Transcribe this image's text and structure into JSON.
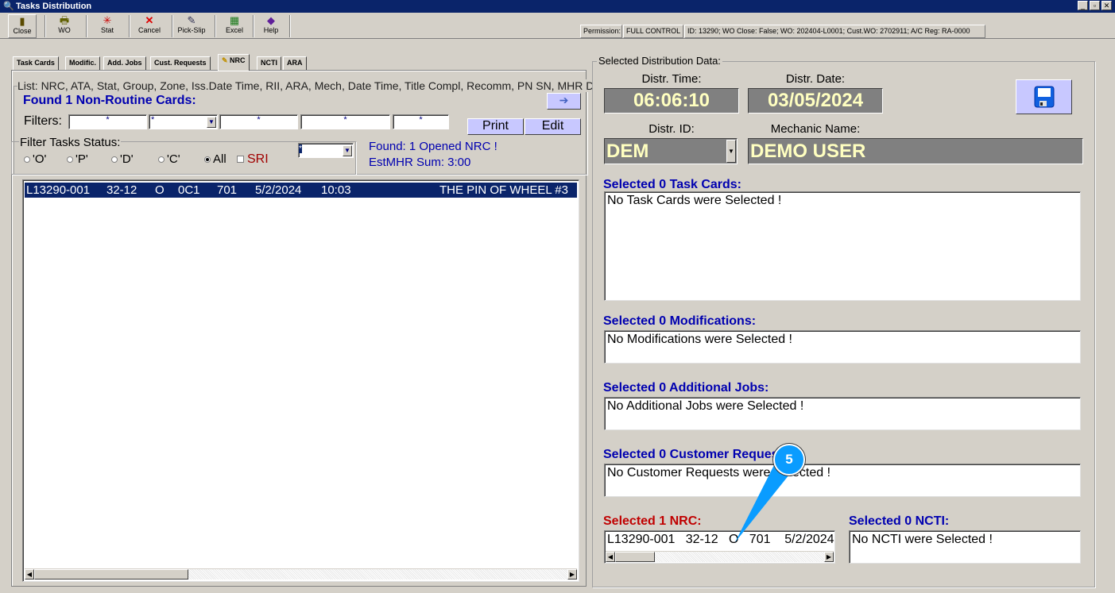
{
  "window": {
    "title": "Tasks Distribution"
  },
  "toolbar": [
    {
      "label": "Close",
      "icon": "door-exit-icon",
      "glyph": "🚪"
    },
    {
      "label": "WO",
      "icon": "printer-icon",
      "glyph": "🖶"
    },
    {
      "label": "Stat",
      "icon": "stat-burst-icon",
      "glyph": "✳"
    },
    {
      "label": "Cancel",
      "icon": "cancel-x-icon",
      "glyph": "✕"
    },
    {
      "label": "Pick-Slip",
      "icon": "pick-slip-icon",
      "glyph": "✎"
    },
    {
      "label": "Excel",
      "icon": "excel-icon",
      "glyph": "▦"
    },
    {
      "label": "Help",
      "icon": "help-book-icon",
      "glyph": "📘"
    }
  ],
  "status": {
    "permission_label": "Permission:",
    "permission_value": "FULL CONTROL",
    "info": "ID: 13290; WO Close: False; WO: 202404-L0001; Cust.WO: 2702911; A/C Reg: RA-0000"
  },
  "tabs": [
    "Task Cards",
    "Modific.",
    "Add. Jobs",
    "Cust. Requests",
    "NRC",
    "NCTI",
    "ARA"
  ],
  "left": {
    "list_caption": "List: NRC, ATA, Stat, Group, Zone, Iss.Date Time, RII, ARA, Mech, Date Time, Title Compl, Recomm, PN SN, MHR DwnT",
    "found_label": "Found 1 Non-Routine Cards:",
    "filters_label": "Filters:",
    "filters": [
      "*",
      "*",
      "*",
      "*",
      "*"
    ],
    "print": "Print",
    "edit": "Edit",
    "status_group": "Filter Tasks Status:",
    "radios": [
      "'O'",
      "'P'",
      "'D'",
      "'C'",
      "All"
    ],
    "sri": "SRI",
    "status_combo": "*",
    "found_opened": "Found: 1 Opened NRC !",
    "estmhr": "EstMHR Sum: 3:00",
    "rows": [
      {
        "nrc": "L13290-001",
        "ata": "32-12",
        "stat": "O",
        "group": "0C1",
        "zone": "701",
        "date": "5/2/2024",
        "time": "10:03",
        "title": "THE PIN OF WHEEL #3"
      }
    ]
  },
  "right": {
    "group_title": "Selected Distribution Data:",
    "time_label": "Distr. Time:",
    "time": "06:06:10",
    "date_label": "Distr. Date:",
    "date": "03/05/2024",
    "id_label": "Distr. ID:",
    "id": "DEM",
    "mech_label": "Mechanic Name:",
    "mech": "DEMO USER",
    "task_cards_label": "Selected 0 Task Cards:",
    "task_cards_text": "No Task Cards were Selected !",
    "mods_label": "Selected 0 Modifications:",
    "mods_text": "No Modifications were Selected !",
    "jobs_label": "Selected 0 Additional Jobs:",
    "jobs_text": "No Additional Jobs were Selected !",
    "cust_label": "Selected 0 Customer Requests:",
    "cust_text": "No Customer Requests were Selected !",
    "nrc_label": "Selected 1 NRC:",
    "nrc_row": "L13290-001   32-12   O   701    5/2/2024",
    "ncti_label": "Selected 0 NCTI:",
    "ncti_text": "No NCTI were Selected !"
  },
  "callout": {
    "number": "5",
    "color": "#0a9cff"
  }
}
